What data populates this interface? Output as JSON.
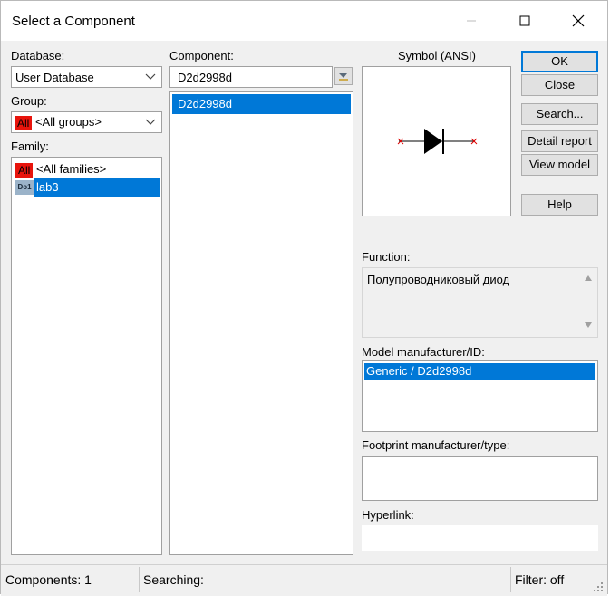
{
  "window": {
    "title": "Select a Component"
  },
  "database": {
    "label": "Database:",
    "value": "User Database"
  },
  "group": {
    "label": "Group:",
    "badge": "All",
    "value": "<All groups>"
  },
  "family": {
    "label": "Family:",
    "items": [
      {
        "badge": "All",
        "label": "<All families>",
        "selected": false
      },
      {
        "badge": "Do1",
        "label": "lab3",
        "selected": true
      }
    ]
  },
  "component": {
    "label": "Component:",
    "search_value": "D2d2998d",
    "items": [
      {
        "label": "D2d2998d",
        "selected": true
      }
    ]
  },
  "symbol": {
    "label": "Symbol (ANSI)"
  },
  "buttons": {
    "ok": "OK",
    "close": "Close",
    "search": "Search...",
    "detail_report": "Detail report",
    "view_model": "View model",
    "help": "Help"
  },
  "function": {
    "label": "Function:",
    "value": "Полупроводниковый диод"
  },
  "model": {
    "label": "Model manufacturer/ID:",
    "items": [
      {
        "label": "Generic / D2d2998d",
        "selected": true
      }
    ]
  },
  "footprint": {
    "label": "Footprint manufacturer/type:"
  },
  "hyperlink": {
    "label": "Hyperlink:"
  },
  "status": {
    "components": "Components: 1",
    "searching": "Searching:",
    "filter": "Filter: off"
  },
  "colors": {
    "selection": "#0078d7",
    "all_badge": "#e8140c"
  }
}
